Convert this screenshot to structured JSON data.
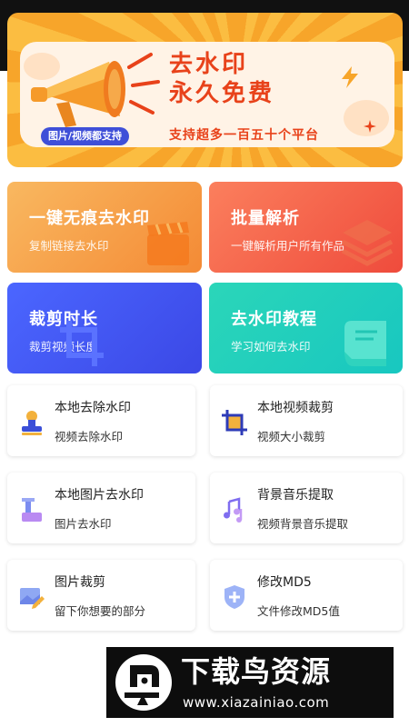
{
  "banner": {
    "title_line1": "去水印",
    "title_line2": "永久免费",
    "pill": "图片/视频都支持",
    "subtitle": "支持超多一百五十个平台"
  },
  "features": [
    {
      "title": "一键无痕去水印",
      "subtitle": "复制链接去水印",
      "icon": "clapperboard-icon"
    },
    {
      "title": "批量解析",
      "subtitle": "一键解析用户所有作品",
      "icon": "layers-icon"
    },
    {
      "title": "裁剪时长",
      "subtitle": "裁剪视频长度",
      "icon": "crop-icon"
    },
    {
      "title": "去水印教程",
      "subtitle": "学习如何去水印",
      "icon": "book-icon"
    }
  ],
  "tools": [
    {
      "title": "本地去除水印",
      "subtitle": "视频去除水印",
      "icon": "stamp-icon"
    },
    {
      "title": "本地视频裁剪",
      "subtitle": "视频大小裁剪",
      "icon": "crop-icon"
    },
    {
      "title": "本地图片去水印",
      "subtitle": "图片去水印",
      "icon": "image-stamp-icon"
    },
    {
      "title": "背景音乐提取",
      "subtitle": "视频背景音乐提取",
      "icon": "music-icon"
    },
    {
      "title": "图片裁剪",
      "subtitle": "留下你想要的部分",
      "icon": "image-edit-icon"
    },
    {
      "title": "修改MD5",
      "subtitle": "文件修改MD5值",
      "icon": "shield-icon"
    }
  ],
  "watermark": {
    "title": "下载鸟资源",
    "url": "www.xiazainiao.com"
  },
  "colors": {
    "banner_orange": "#f7a52a",
    "banner_red_text": "#e8421a",
    "pill_blue": "#3f4fd8",
    "card_orange": "#f48a35",
    "card_red": "#ef4b3c",
    "card_blue": "#3b48e6",
    "card_teal": "#18c7c0"
  }
}
